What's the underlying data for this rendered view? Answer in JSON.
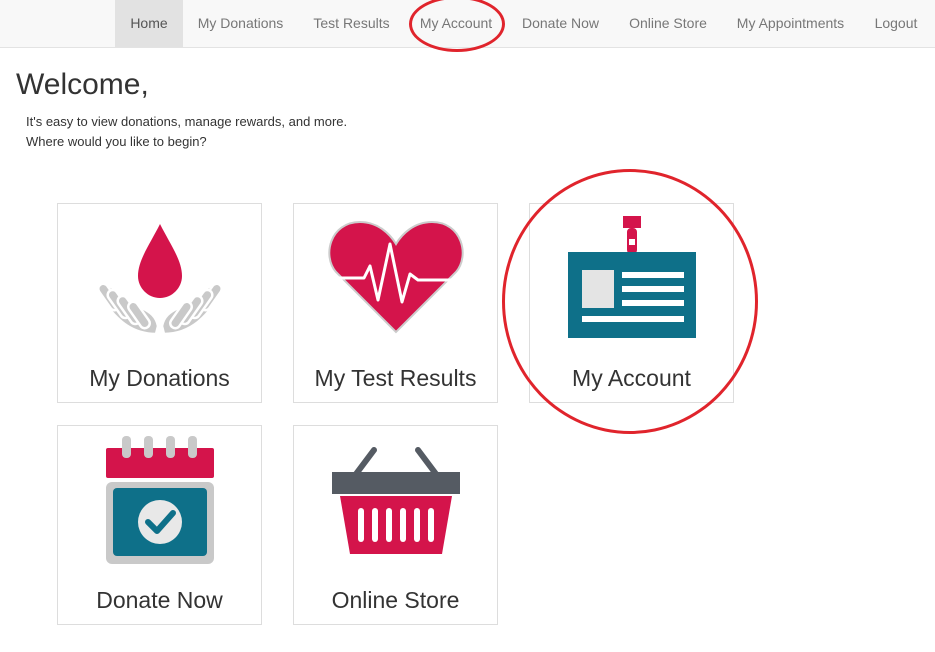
{
  "nav": {
    "items": [
      {
        "label": "Home",
        "active": true
      },
      {
        "label": "My Donations"
      },
      {
        "label": "Test Results"
      },
      {
        "label": "My Account"
      },
      {
        "label": "Donate Now"
      },
      {
        "label": "Online Store"
      },
      {
        "label": "My Appointments"
      },
      {
        "label": "Logout"
      }
    ]
  },
  "page": {
    "title": "Welcome,",
    "intro_line1": "It's easy to view donations, manage rewards, and more.",
    "intro_line2": "Where would you like to begin?"
  },
  "tiles": [
    {
      "label": "My Donations",
      "icon": "blood-drop-hands-icon"
    },
    {
      "label": "My Test Results",
      "icon": "heart-pulse-icon"
    },
    {
      "label": "My Account",
      "icon": "id-badge-icon"
    },
    {
      "label": "Donate Now",
      "icon": "calendar-check-icon"
    },
    {
      "label": "Online Store",
      "icon": "shopping-basket-icon"
    }
  ],
  "colors": {
    "brand_red": "#d4144b",
    "teal": "#0e7089",
    "gray": "#c9c9c9",
    "annotation_red": "#e0242c"
  }
}
